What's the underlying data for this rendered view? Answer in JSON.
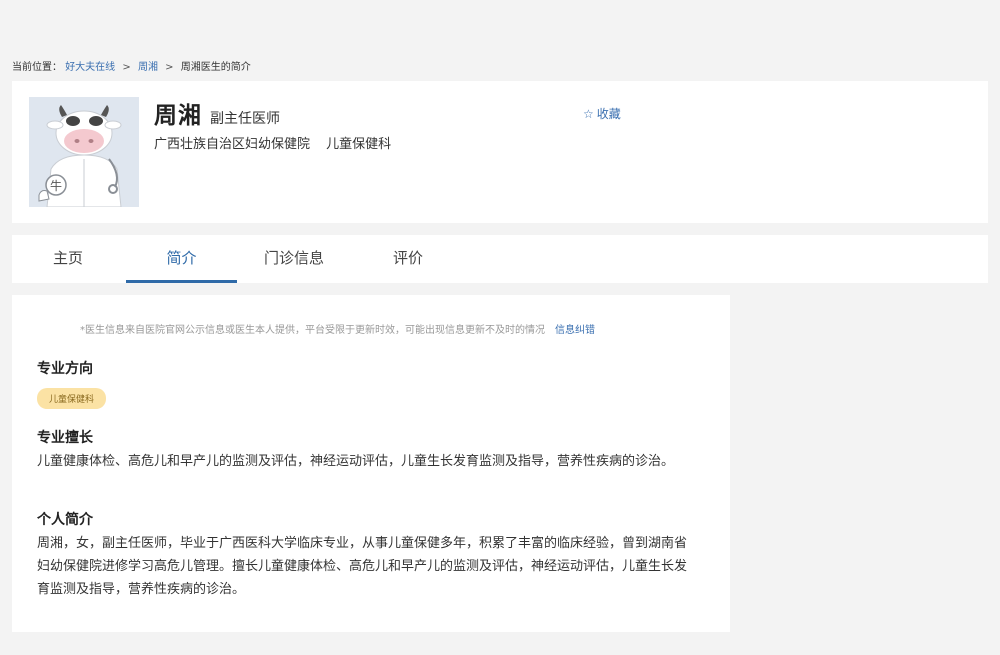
{
  "breadcrumb": {
    "prefix": "当前位置：",
    "items": [
      "好大夫在线",
      "周湘",
      "周湘医生的简介"
    ],
    "separator": ">"
  },
  "doctor": {
    "name": "周湘",
    "title": "副主任医师",
    "hospital": "广西壮族自治区妇幼保健院",
    "department": "儿童保健科",
    "avatar_glyph": "牛"
  },
  "favorite": {
    "icon": "star-outline-icon",
    "label": "收藏"
  },
  "tabs": [
    {
      "label": "主页",
      "active": false
    },
    {
      "label": "简介",
      "active": true
    },
    {
      "label": "门诊信息",
      "active": false
    },
    {
      "label": "评价",
      "active": false
    }
  ],
  "intro": {
    "notice": "*医生信息来自医院官网公示信息或医生本人提供，平台受限于更新时效，可能出现信息更新不及时的情况",
    "notice_link": "信息纠错",
    "specialty_heading": "专业方向",
    "specialty_tag": "儿童保健科",
    "expertise_heading": "专业擅长",
    "expertise_text": "儿童健康体检、高危儿和早产儿的监测及评估，神经运动评估，儿童生长发育监测及指导，营养性疾病的诊治。",
    "bio_heading": "个人简介",
    "bio_text": "周湘，女，副主任医师，毕业于广西医科大学临床专业，从事儿童保健多年，积累了丰富的临床经验，曾到湖南省妇幼保健院进修学习高危儿管理。擅长儿童健康体检、高危儿和早产儿的监测及评估，神经运动评估，儿童生长发育监测及指导，营养性疾病的诊治。"
  },
  "colors": {
    "link": "#3a6fb0",
    "active_tab": "#2f6aa8",
    "tag_bg": "#fbe2a4",
    "page_bg": "#f3f3f3"
  }
}
